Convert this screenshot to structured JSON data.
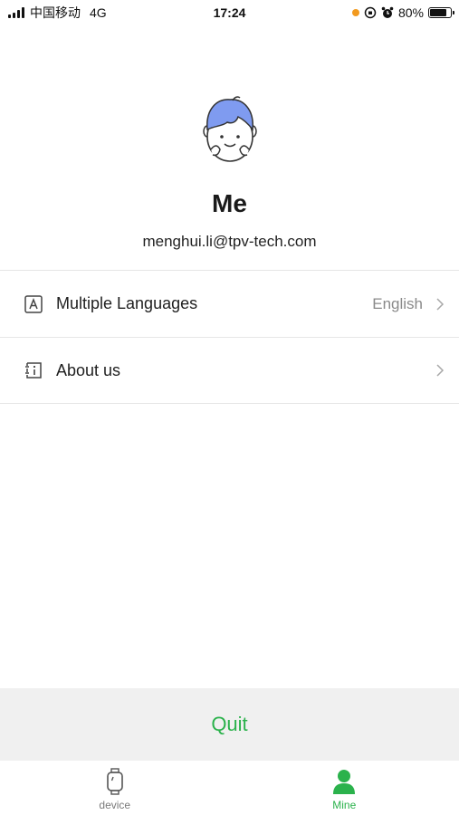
{
  "status_bar": {
    "carrier": "中国移动",
    "network": "4G",
    "time": "17:24",
    "battery_text": "80%",
    "battery_level": 0.8
  },
  "profile": {
    "name": "Me",
    "email": "menghui.li@tpv-tech.com",
    "avatar_icon": "cartoon-avatar-icon"
  },
  "menu": {
    "items": [
      {
        "icon": "language-icon",
        "label": "Multiple Languages",
        "value": "English"
      },
      {
        "icon": "info-icon",
        "label": "About us",
        "value": ""
      }
    ]
  },
  "quit": {
    "label": "Quit"
  },
  "tabs": [
    {
      "icon": "watch-icon",
      "label": "device",
      "active": false
    },
    {
      "icon": "person-icon",
      "label": "Mine",
      "active": true
    }
  ],
  "colors": {
    "accent": "#2bb24c",
    "quit_bg": "#f0f0f0",
    "status_dot": "#f29a1f",
    "avatar_hair": "#7f9bf0"
  }
}
